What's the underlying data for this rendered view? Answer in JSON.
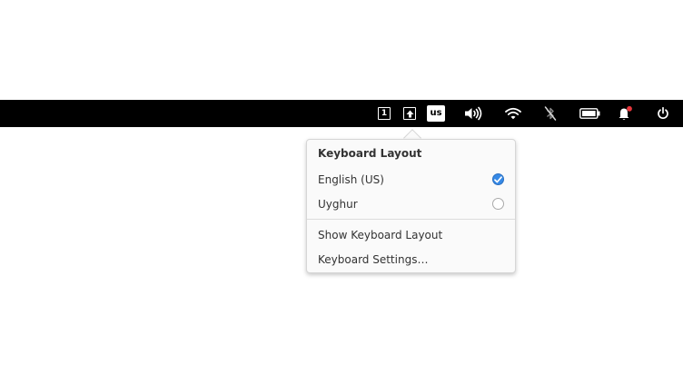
{
  "panel": {
    "indicators": {
      "num_lock": "1",
      "layout_badge": "us"
    },
    "icons": [
      "num-lock-icon",
      "caps-lock-icon",
      "keyboard-layout-icon",
      "volume-icon",
      "wifi-icon",
      "bluetooth-disabled-icon",
      "battery-icon",
      "notifications-icon",
      "power-icon"
    ],
    "colors": {
      "panel_background": "#000000",
      "notification_dot": "#e5363c"
    }
  },
  "popover": {
    "title": "Keyboard Layout",
    "layouts": [
      {
        "label": "English (US)",
        "selected": true
      },
      {
        "label": "Uyghur",
        "selected": false
      }
    ],
    "actions": [
      {
        "label": "Show Keyboard Layout"
      },
      {
        "label": "Keyboard Settings…"
      }
    ],
    "colors": {
      "accent": "#3689e6"
    }
  }
}
